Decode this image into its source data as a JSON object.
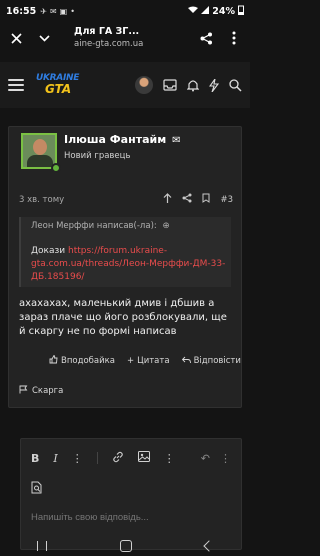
{
  "status": {
    "time": "16:55",
    "battery": "24%"
  },
  "browser": {
    "title": "Для ГА ЗГ...",
    "url": "aine-gta.com.ua"
  },
  "site": {
    "logo_top": "UKRAINE",
    "logo_bottom": "GTA"
  },
  "post": {
    "username": "Ілюша Фантайм",
    "user_title": "Новий гравець",
    "time_ago": "3 хв. тому",
    "post_number": "#3",
    "quote": {
      "header": "Леон Мерффи написав(-ла):",
      "proof_label": "Докази",
      "link": "https://forum.ukraine-gta.com.ua/threads/Леон-Мерффи-ДМ-33-ДБ.185196/"
    },
    "text": "ахахахах, маленький дмив і дбшив а зараз плаче що його розблокували, ще й скаргу не по формі написав",
    "actions": {
      "like": "Вподобайка",
      "quote": "Цитата",
      "reply": "Відповісти"
    },
    "report": "Скарга"
  },
  "editor": {
    "placeholder": "Напишіть свою відповідь..."
  },
  "colors": {
    "background": "#141414",
    "card": "#232323",
    "link": "#e84c4c",
    "online": "#63b33c",
    "logo_blue": "#2f7de1",
    "logo_yellow": "#f2c21b"
  }
}
